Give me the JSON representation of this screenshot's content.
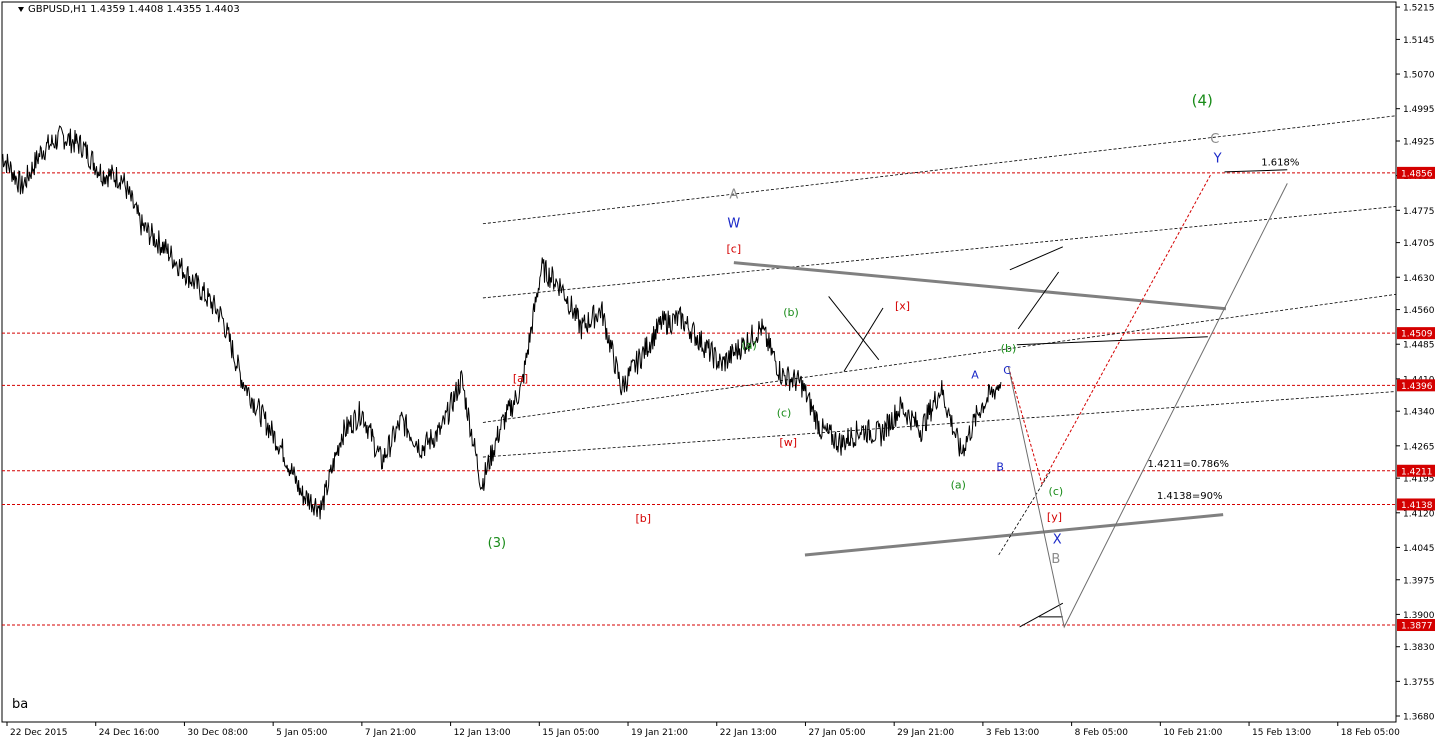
{
  "header": {
    "title": "GBPUSD,H1  1.4359 1.4408 1.4355 1.4403"
  },
  "corner_label": "ba",
  "colors": {
    "price": "#000000",
    "level": "#d40000",
    "red_label": "#d40000",
    "green_label": "#1a8c1a",
    "blue_label": "#1a28c8",
    "gray_label": "#8c8c8c",
    "trendline": "#808080",
    "price_tag_bg": "#d40000",
    "price_tag_text": "#ffffff"
  },
  "chart_data": {
    "type": "line",
    "ylim": [
      1.3667,
      1.5226
    ],
    "y_ticks": [
      "1.5215",
      "1.5145",
      "1.5070",
      "1.4995",
      "1.4925",
      "1.4850",
      "1.4775",
      "1.4705",
      "1.4630",
      "1.4560",
      "1.4485",
      "1.4410",
      "1.4340",
      "1.4265",
      "1.4195",
      "1.4120",
      "1.4045",
      "1.3975",
      "1.3900",
      "1.3830",
      "1.3755",
      "1.3680"
    ],
    "x_ticks": [
      "22 Dec 2015",
      "24 Dec 16:00",
      "30 Dec 08:00",
      "5 Jan 05:00",
      "7 Jan 21:00",
      "12 Jan 13:00",
      "15 Jan 05:00",
      "19 Jan 21:00",
      "22 Jan 13:00",
      "27 Jan 05:00",
      "29 Jan 21:00",
      "3 Feb 13:00",
      "8 Feb 05:00",
      "10 Feb 21:00",
      "15 Feb 13:00",
      "18 Feb 05:00"
    ],
    "series": [
      {
        "x": [
          0,
          0.02,
          0.04,
          0.06,
          0.08,
          0.1,
          0.12,
          0.14,
          0.16,
          0.18,
          0.2,
          0.22,
          0.24,
          0.26,
          0.28,
          0.3,
          0.32,
          0.34,
          0.36,
          0.38,
          0.4,
          0.42,
          0.44,
          0.46,
          0.48,
          0.5,
          0.52,
          0.54,
          0.56,
          0.58,
          0.6,
          0.62,
          0.64,
          0.66,
          0.68,
          0.7,
          0.72,
          0.74,
          0.76,
          0.78,
          0.8,
          0.82,
          0.84,
          0.86,
          0.88,
          0.9,
          0.92,
          0.94,
          0.96,
          0.98,
          1
        ],
        "y": [
          1.4895,
          1.4825,
          1.4905,
          1.4935,
          1.4915,
          1.4855,
          1.4845,
          1.474,
          1.47,
          1.465,
          1.46,
          1.4545,
          1.441,
          1.433,
          1.426,
          1.416,
          1.413,
          1.429,
          1.434,
          1.423,
          1.432,
          1.426,
          1.43,
          1.441,
          1.418,
          1.431,
          1.439,
          1.465,
          1.461,
          1.452,
          1.456,
          1.439,
          1.446,
          1.453,
          1.454,
          1.449,
          1.444,
          1.448,
          1.452,
          1.442,
          1.44,
          1.43,
          1.427,
          1.43,
          1.429,
          1.435,
          1.43,
          1.439,
          1.425,
          1.435,
          1.4403
        ]
      }
    ],
    "levels": [
      {
        "value": 1.4856,
        "label": "1.4856"
      },
      {
        "value": 1.4509,
        "label": "1.4509"
      },
      {
        "value": 1.4396,
        "label": "1.4396"
      },
      {
        "value": 1.4211,
        "label": "1.4211"
      },
      {
        "value": 1.4138,
        "label": "1.4138"
      },
      {
        "value": 1.3877,
        "label": "1.3877"
      }
    ],
    "annotations": {
      "green": [
        "(4)",
        "(3)",
        "(b)",
        "(a)",
        "(c)",
        "(b)",
        "(a)",
        "(c)"
      ],
      "red": [
        "[c]",
        "[x]",
        "[a]",
        "[w]",
        "[b]",
        "[y]"
      ],
      "blue": [
        "W",
        "Y",
        "A",
        "C",
        "B",
        "X"
      ],
      "gray": [
        "A",
        "C",
        "B"
      ],
      "black": [
        "1.618%",
        "1.4211=0.786%",
        "1.4138=90%"
      ]
    }
  }
}
